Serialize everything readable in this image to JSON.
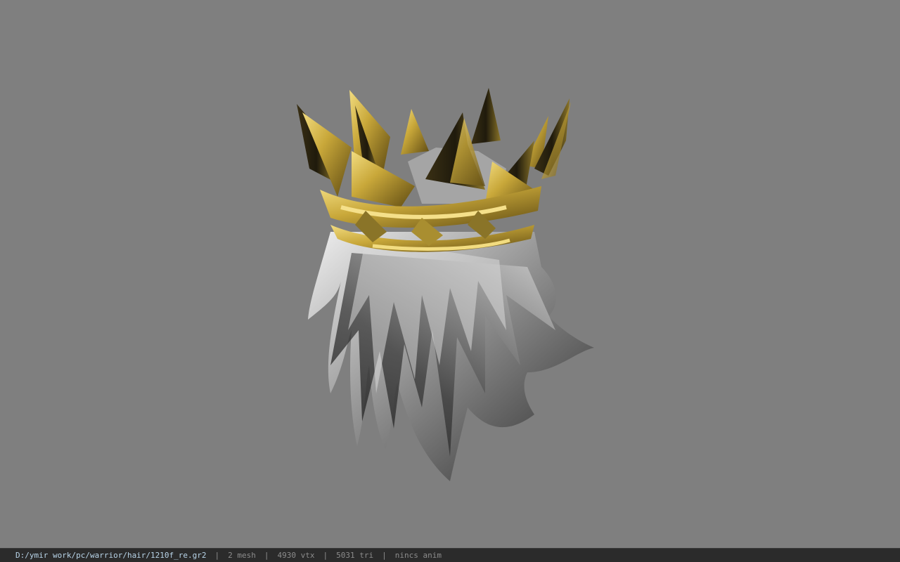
{
  "status": {
    "file_path": "D:/ymir work/pc/warrior/hair/1210f_re.gr2",
    "separator": "|",
    "mesh": "2 mesh",
    "vtx": "4930 vtx",
    "tri": "5031 tri",
    "anim": "nincs anim"
  },
  "colors": {
    "background": "#7f7f7f",
    "status_bar": "#2b2b2b",
    "gold": "#c9a83a",
    "hair": "#c8c8c8"
  }
}
